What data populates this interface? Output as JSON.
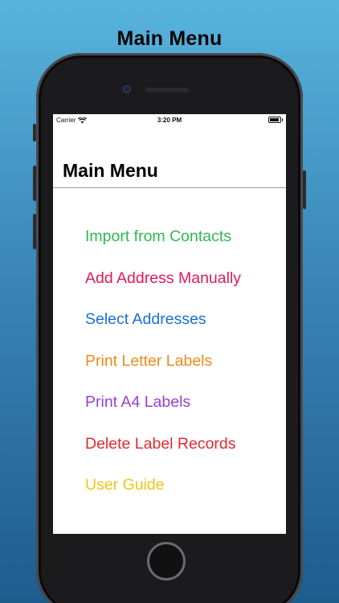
{
  "caption": "Main Menu",
  "status_bar": {
    "carrier": "Carrier",
    "time": "3:20 PM",
    "wifi_icon": "wifi-icon",
    "battery_icon": "battery-icon"
  },
  "nav": {
    "title": "Main Menu"
  },
  "menu": {
    "items": [
      {
        "label": "Import from Contacts",
        "color": "#2eb84e"
      },
      {
        "label": "Add Address Manually",
        "color": "#e3195a"
      },
      {
        "label": "Select Addresses",
        "color": "#1a6fd8"
      },
      {
        "label": "Print Letter Labels",
        "color": "#f0891c"
      },
      {
        "label": "Print A4 Labels",
        "color": "#9b3fce"
      },
      {
        "label": "Delete Label Records",
        "color": "#e02a31"
      },
      {
        "label": "User Guide",
        "color": "#f2c414"
      }
    ]
  },
  "colors": {
    "background_top": "#58b4dc",
    "background_bottom": "#1e5c8c",
    "phone_body": "#1b1b1d",
    "screen": "#ffffff"
  }
}
